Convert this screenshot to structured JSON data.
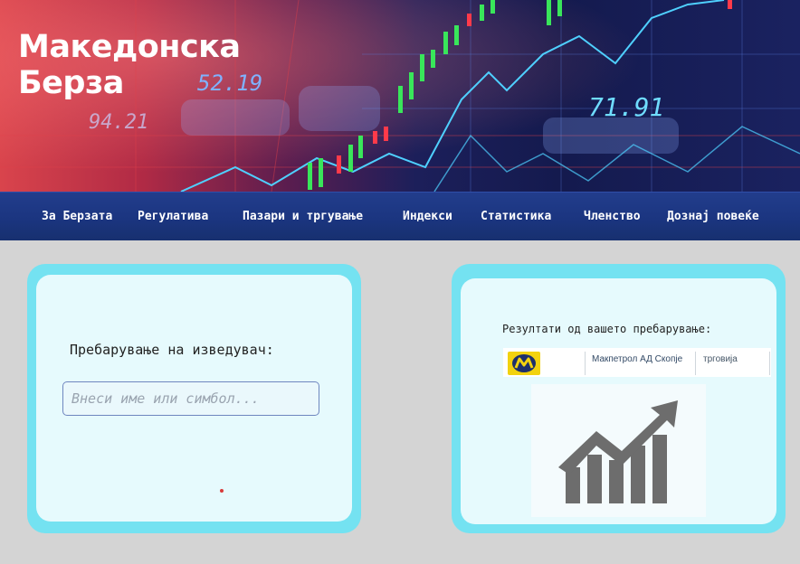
{
  "site": {
    "title_line1": "Македонска",
    "title_line2": "Берза"
  },
  "nav": {
    "items": [
      {
        "label": "За Берзата"
      },
      {
        "label": "Регулатива"
      },
      {
        "label": "Пазари и тргување"
      },
      {
        "label": "Индекси"
      },
      {
        "label": "Статистика"
      },
      {
        "label": "Членство"
      },
      {
        "label": "Дознај повеќе"
      }
    ]
  },
  "hero_numbers": [
    "52.19",
    "94.21",
    "71.91"
  ],
  "search": {
    "label": "Пребарување на изведувач:",
    "placeholder": "Внеси име или симбол...",
    "value": ""
  },
  "results": {
    "label": "Резултати од вашето пребарување:",
    "items": [
      {
        "name": "Макпетрол АД Скопје",
        "sector": "трговија",
        "logo": "makpetrol-logo"
      }
    ],
    "chart_icon": "growth-chart-icon"
  },
  "colors": {
    "nav_bg": "#1b3580",
    "card_border": "#74e2f1",
    "card_bg": "#e6fafd",
    "logo_yellow": "#f2d20f",
    "chart_icon_gray": "#6d6d6d"
  }
}
